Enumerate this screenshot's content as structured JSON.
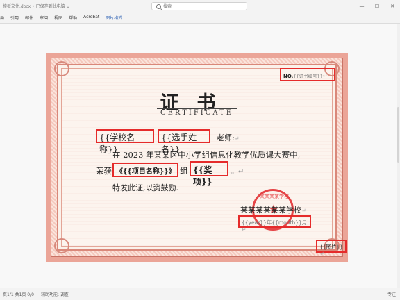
{
  "window": {
    "doc_title": "模板文件.docx • 已保存到此电脑 ⌄",
    "search_placeholder": "搜索"
  },
  "ribbon": {
    "tabs": [
      "局",
      "引用",
      "邮件",
      "审阅",
      "视图",
      "帮助",
      "Acrobat",
      "图片格式"
    ],
    "active_tab": "图片格式"
  },
  "certificate": {
    "no_label": "NO.",
    "no_value": "{{证书编号}}",
    "title_cn": "证书",
    "title_en": "CERTIFICATE",
    "school": "{{学校名称}}",
    "player": "{{选手姓名}}",
    "teacher": "老师:",
    "body_line": "在 2023 年某某区中小学组信息化教学优质课大赛中,",
    "award_prefix": "荣获",
    "project": "《{{项目名称}}》",
    "group_word": "组",
    "award": "{{奖项}}",
    "period": "。",
    "encourage": "特发此证,以资鼓励.",
    "signer": "某某某某某某学校",
    "date": "{{year}}年{{month}}月",
    "picture": "{{图片}}",
    "return_mark": "↵",
    "seal_text": "某某某某学校"
  },
  "status": {
    "left": "页1/1 共1页 0/0",
    "accessibility": "辅助功能: 调查",
    "right": "专注"
  },
  "colors": {
    "highlight": "#e52b2b",
    "border_pink": "#eba598",
    "seal_red": "#e2272a",
    "active_tab": "#2b5fb3"
  }
}
